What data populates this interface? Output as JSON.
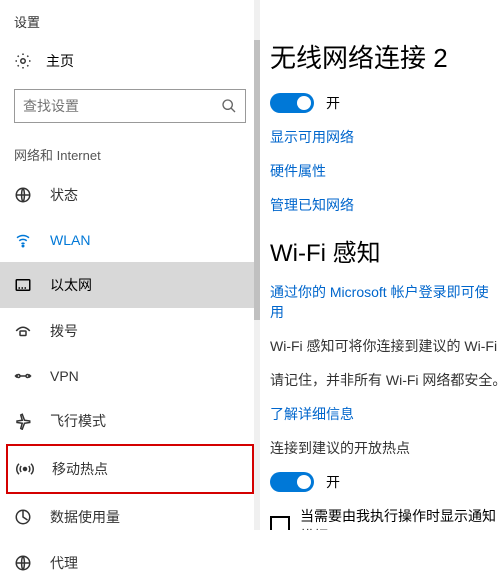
{
  "app_title": "设置",
  "home_label": "主页",
  "search_placeholder": "查找设置",
  "section_label": "网络和 Internet",
  "nav": [
    {
      "key": "status",
      "label": "状态"
    },
    {
      "key": "wlan",
      "label": "WLAN"
    },
    {
      "key": "ethernet",
      "label": "以太网"
    },
    {
      "key": "dialup",
      "label": "拨号"
    },
    {
      "key": "vpn",
      "label": "VPN"
    },
    {
      "key": "airplane",
      "label": "飞行模式"
    },
    {
      "key": "hotspot",
      "label": "移动热点"
    },
    {
      "key": "datausage",
      "label": "数据使用量"
    },
    {
      "key": "proxy",
      "label": "代理"
    }
  ],
  "main": {
    "heading": "无线网络连接 2",
    "toggle1_label": "开",
    "link_show_networks": "显示可用网络",
    "link_hw_props": "硬件属性",
    "link_manage_known": "管理已知网络",
    "sense_heading": "Wi-Fi 感知",
    "sense_login": "通过你的 Microsoft 帐户登录即可使用",
    "sense_desc1": "Wi-Fi 感知可将你连接到建议的 Wi-Fi 热",
    "sense_desc2": "请记住，并非所有 Wi-Fi 网络都安全。",
    "link_learn_more": "了解详细信息",
    "connect_label": "连接到建议的开放热点",
    "toggle2_label": "开",
    "checkbox_label": "当需要由我执行操作时显示通知横幅"
  }
}
